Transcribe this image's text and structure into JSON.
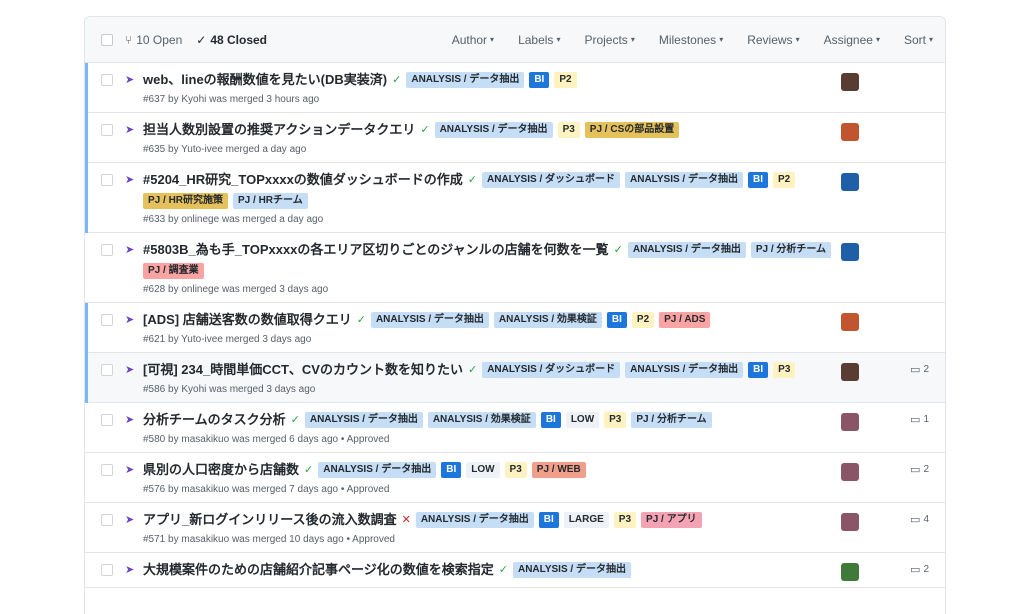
{
  "header": {
    "open_label": "10 Open",
    "closed_label": "48 Closed",
    "filters": [
      {
        "name": "author",
        "label": "Author"
      },
      {
        "name": "labels",
        "label": "Labels"
      },
      {
        "name": "projects",
        "label": "Projects"
      },
      {
        "name": "milestones",
        "label": "Milestones"
      },
      {
        "name": "reviews",
        "label": "Reviews"
      },
      {
        "name": "assignee",
        "label": "Assignee"
      },
      {
        "name": "sort",
        "label": "Sort"
      }
    ]
  },
  "colors": {
    "accent_bar": "#79b8ff",
    "merged": "#6f42c1",
    "check_ok": "#28a745",
    "check_fail": "#cb2431"
  },
  "rows": [
    {
      "title": "web、lineの報酬数値を見たい(DB実装済)",
      "status": "ok",
      "labels": [
        {
          "text": "ANALYSIS / データ抽出",
          "bg": "#c5def5",
          "fg": "#24292e"
        },
        {
          "text": "BI",
          "bg": "#1d76db",
          "fg": "#ffffff"
        },
        {
          "text": "P2",
          "bg": "#fef2c0",
          "fg": "#24292e"
        }
      ],
      "meta": "#637 by Kyohi was merged 3 hours ago",
      "avatar": "#5a3d32",
      "comments": "",
      "bar": true,
      "hl": false
    },
    {
      "title": "担当人数別設置の推奨アクションデータクエリ",
      "status": "ok",
      "labels": [
        {
          "text": "ANALYSIS / データ抽出",
          "bg": "#c5def5",
          "fg": "#24292e"
        },
        {
          "text": "P3",
          "bg": "#fef2c0",
          "fg": "#24292e"
        },
        {
          "text": "PJ / CSの部品設置",
          "bg": "#e4c15a",
          "fg": "#24292e"
        }
      ],
      "meta": "#635 by Yuto-ivee merged a day ago",
      "avatar": "#c0552f",
      "comments": "",
      "bar": true,
      "hl": false
    },
    {
      "title": "#5204_HR研究_TOPxxxxの数値ダッシュボードの作成",
      "status": "ok",
      "labels": [
        {
          "text": "ANALYSIS / ダッシュボード",
          "bg": "#c5def5",
          "fg": "#24292e"
        },
        {
          "text": "ANALYSIS / データ抽出",
          "bg": "#c5def5",
          "fg": "#24292e"
        },
        {
          "text": "BI",
          "bg": "#1d76db",
          "fg": "#ffffff"
        },
        {
          "text": "P2",
          "bg": "#fef2c0",
          "fg": "#24292e"
        },
        {
          "text": "PJ / HR研究施策",
          "bg": "#e4c15a",
          "fg": "#24292e"
        },
        {
          "text": "PJ / HRチーム",
          "bg": "#c5def5",
          "fg": "#24292e"
        }
      ],
      "meta": "#633 by onlinege was merged a day ago",
      "avatar": "#1f5fa8",
      "comments": "",
      "bar": true,
      "hl": false
    },
    {
      "title": "#5803B_為も手_TOPxxxxの各エリア区切りごとのジャンルの店舗を何数を一覧",
      "status": "ok",
      "labels": [
        {
          "text": "ANALYSIS / データ抽出",
          "bg": "#c5def5",
          "fg": "#24292e"
        },
        {
          "text": "PJ / 分析チーム",
          "bg": "#c5def5",
          "fg": "#24292e"
        },
        {
          "text": "PJ / 調査業",
          "bg": "#f9a3a3",
          "fg": "#24292e"
        }
      ],
      "meta": "#628 by onlinege was merged 3 days ago",
      "avatar": "#1f5fa8",
      "comments": "",
      "bar": false,
      "hl": false
    },
    {
      "title": "[ADS] 店舗送客数の数値取得クエリ",
      "status": "ok",
      "labels": [
        {
          "text": "ANALYSIS / データ抽出",
          "bg": "#c5def5",
          "fg": "#24292e"
        },
        {
          "text": "ANALYSIS / 効果検証",
          "bg": "#c5def5",
          "fg": "#24292e"
        },
        {
          "text": "BI",
          "bg": "#1d76db",
          "fg": "#ffffff"
        },
        {
          "text": "P2",
          "bg": "#fef2c0",
          "fg": "#24292e"
        },
        {
          "text": "PJ / ADS",
          "bg": "#f9a3a3",
          "fg": "#24292e"
        }
      ],
      "meta": "#621 by Yuto-ivee merged 3 days ago",
      "avatar": "#c0552f",
      "comments": "",
      "bar": true,
      "hl": false
    },
    {
      "title": "[可視] 234_時間単価CCT、CVのカウント数を知りたい",
      "status": "ok",
      "labels": [
        {
          "text": "ANALYSIS / ダッシュボード",
          "bg": "#c5def5",
          "fg": "#24292e"
        },
        {
          "text": "ANALYSIS / データ抽出",
          "bg": "#c5def5",
          "fg": "#24292e"
        },
        {
          "text": "BI",
          "bg": "#1d76db",
          "fg": "#ffffff"
        },
        {
          "text": "P3",
          "bg": "#fef2c0",
          "fg": "#24292e"
        }
      ],
      "meta": "#586 by Kyohi was merged 3 days ago",
      "avatar": "#5a3d32",
      "comments": "2",
      "bar": true,
      "hl": true
    },
    {
      "title": "分析チームのタスク分析",
      "status": "ok",
      "labels": [
        {
          "text": "ANALYSIS / データ抽出",
          "bg": "#c5def5",
          "fg": "#24292e"
        },
        {
          "text": "ANALYSIS / 効果検証",
          "bg": "#c5def5",
          "fg": "#24292e"
        },
        {
          "text": "BI",
          "bg": "#1d76db",
          "fg": "#ffffff"
        },
        {
          "text": "LOW",
          "bg": "#eef2f6",
          "fg": "#24292e"
        },
        {
          "text": "P3",
          "bg": "#fef2c0",
          "fg": "#24292e"
        },
        {
          "text": "PJ / 分析チーム",
          "bg": "#c5def5",
          "fg": "#24292e"
        }
      ],
      "meta": "#580 by masakikuo was merged 6 days ago • Approved",
      "avatar": "#8a5566",
      "comments": "1",
      "bar": false,
      "hl": false
    },
    {
      "title": "県別の人口密度から店舗数",
      "status": "ok",
      "labels": [
        {
          "text": "ANALYSIS / データ抽出",
          "bg": "#c5def5",
          "fg": "#24292e"
        },
        {
          "text": "BI",
          "bg": "#1d76db",
          "fg": "#ffffff"
        },
        {
          "text": "LOW",
          "bg": "#eef2f6",
          "fg": "#24292e"
        },
        {
          "text": "P3",
          "bg": "#fef2c0",
          "fg": "#24292e"
        },
        {
          "text": "PJ / WEB",
          "bg": "#f0a08a",
          "fg": "#24292e"
        }
      ],
      "meta": "#576 by masakikuo was merged 7 days ago • Approved",
      "avatar": "#8a5566",
      "comments": "2",
      "bar": false,
      "hl": false
    },
    {
      "title": "アプリ_新ログインリリース後の流入数調査",
      "status": "fail",
      "labels": [
        {
          "text": "ANALYSIS / データ抽出",
          "bg": "#c5def5",
          "fg": "#24292e"
        },
        {
          "text": "BI",
          "bg": "#1d76db",
          "fg": "#ffffff"
        },
        {
          "text": "LARGE",
          "bg": "#eef2f6",
          "fg": "#24292e"
        },
        {
          "text": "P3",
          "bg": "#fef2c0",
          "fg": "#24292e"
        },
        {
          "text": "PJ / アプリ",
          "bg": "#f4a3b5",
          "fg": "#24292e"
        }
      ],
      "meta": "#571 by masakikuo was merged 10 days ago • Approved",
      "avatar": "#8a5566",
      "comments": "4",
      "bar": false,
      "hl": false
    },
    {
      "title": "大規模案件のための店舗紹介記事ページ化の数値を検索指定",
      "status": "ok",
      "labels": [
        {
          "text": "ANALYSIS / データ抽出",
          "bg": "#c5def5",
          "fg": "#24292e"
        }
      ],
      "meta": "",
      "avatar": "#3f7a3a",
      "comments": "2",
      "bar": false,
      "hl": false
    }
  ]
}
